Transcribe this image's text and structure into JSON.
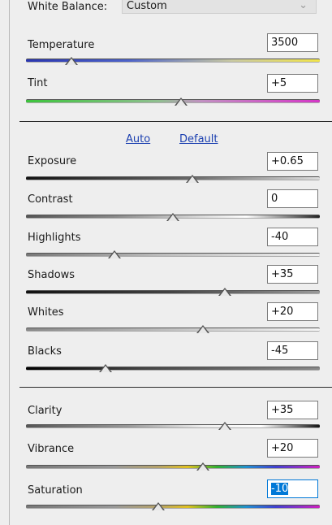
{
  "white_balance": {
    "label": "White Balance:",
    "value": "Custom"
  },
  "basic": [
    {
      "id": "temperature",
      "label": "Temperature",
      "value": "3500"
    },
    {
      "id": "tint",
      "label": "Tint",
      "value": "+5"
    }
  ],
  "tone_links": {
    "auto": "Auto",
    "default": "Default"
  },
  "tone": [
    {
      "id": "exposure",
      "label": "Exposure",
      "value": "+0.65"
    },
    {
      "id": "contrast",
      "label": "Contrast",
      "value": "0"
    },
    {
      "id": "highlights",
      "label": "Highlights",
      "value": "-40"
    },
    {
      "id": "shadows",
      "label": "Shadows",
      "value": "+35"
    },
    {
      "id": "whites",
      "label": "Whites",
      "value": "+20"
    },
    {
      "id": "blacks",
      "label": "Blacks",
      "value": "-45"
    }
  ],
  "presence": [
    {
      "id": "clarity",
      "label": "Clarity",
      "value": "+35"
    },
    {
      "id": "vibrance",
      "label": "Vibrance",
      "value": "+20"
    },
    {
      "id": "saturation",
      "label": "Saturation",
      "value": "-10"
    }
  ]
}
